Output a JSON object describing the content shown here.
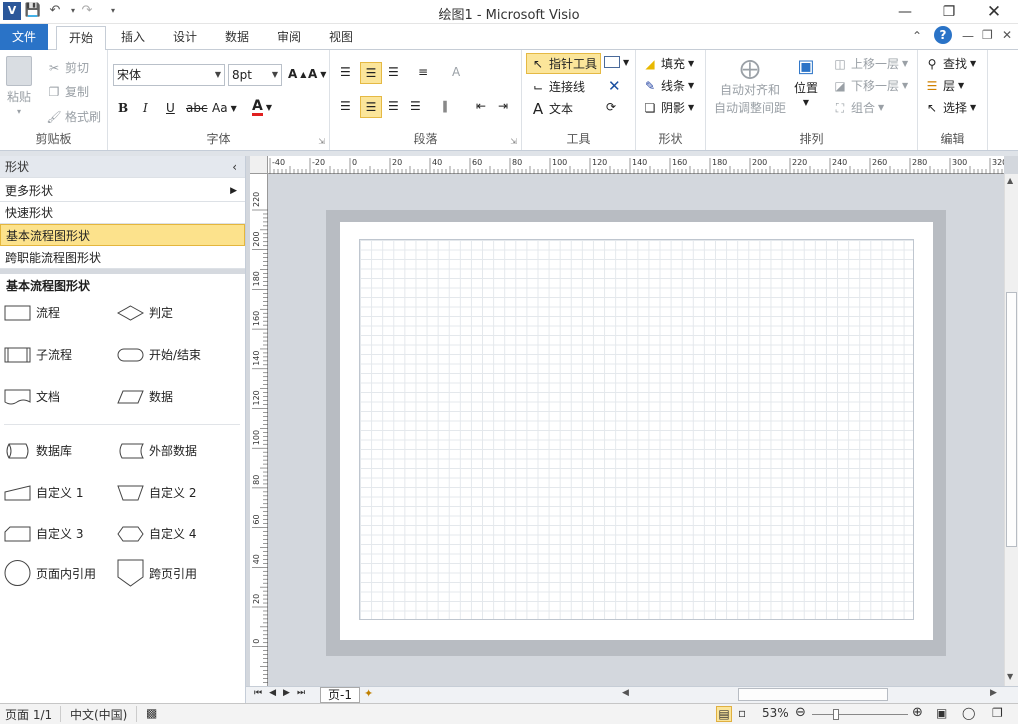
{
  "app": {
    "title": "绘图1  -  Microsoft Visio",
    "accent": "#2a73c7"
  },
  "tabs": [
    "文件",
    "开始",
    "插入",
    "设计",
    "数据",
    "审阅",
    "视图"
  ],
  "ribbon": {
    "clipboard": {
      "label": "剪贴板",
      "paste": "粘贴",
      "cut": "剪切",
      "copy": "复制",
      "format_painter": "格式刷"
    },
    "font": {
      "label": "字体",
      "family": "宋体",
      "size": "8pt",
      "bold": "B",
      "italic": "I",
      "underline": "U",
      "strike": "abc",
      "aa": "Aa"
    },
    "paragraph": {
      "label": "段落"
    },
    "tools": {
      "label": "工具",
      "pointer": "指针工具",
      "connector": "连接线",
      "text": "文本"
    },
    "shape": {
      "label": "形状",
      "fill": "填充",
      "line": "线条",
      "shadow": "阴影"
    },
    "arrange": {
      "label": "排列",
      "auto_align": "自动对齐和",
      "auto_space": "自动调整间距",
      "position": "位置",
      "bring_forward": "上移一层",
      "send_backward": "下移一层",
      "group": "组合"
    },
    "editing": {
      "label": "编辑",
      "find": "查找",
      "layers": "层",
      "select": "选择"
    }
  },
  "panel": {
    "header": "形状",
    "rows": [
      "更多形状",
      "快速形状",
      "基本流程图形状",
      "跨职能流程图形状"
    ],
    "section": "基本流程图形状",
    "shapes": [
      "流程",
      "判定",
      "子流程",
      "开始/结束",
      "文档",
      "数据",
      "数据库",
      "外部数据",
      "自定义 1",
      "自定义 2",
      "自定义 3",
      "自定义 4",
      "页面内引用",
      "跨页引用"
    ]
  },
  "ruler": {
    "h": [
      "-40",
      "-20",
      "0",
      "20",
      "40",
      "60",
      "80",
      "100",
      "120",
      "140",
      "160",
      "180",
      "200",
      "220",
      "240",
      "260",
      "280",
      "300",
      "320"
    ],
    "v": [
      "220",
      "200",
      "180",
      "160",
      "140",
      "120",
      "100",
      "80",
      "60",
      "40",
      "20",
      "0"
    ]
  },
  "pagebar": {
    "page_tab": "页-1"
  },
  "status": {
    "page": "页面 1/1",
    "language": "中文(中国)",
    "zoom": "53%"
  }
}
